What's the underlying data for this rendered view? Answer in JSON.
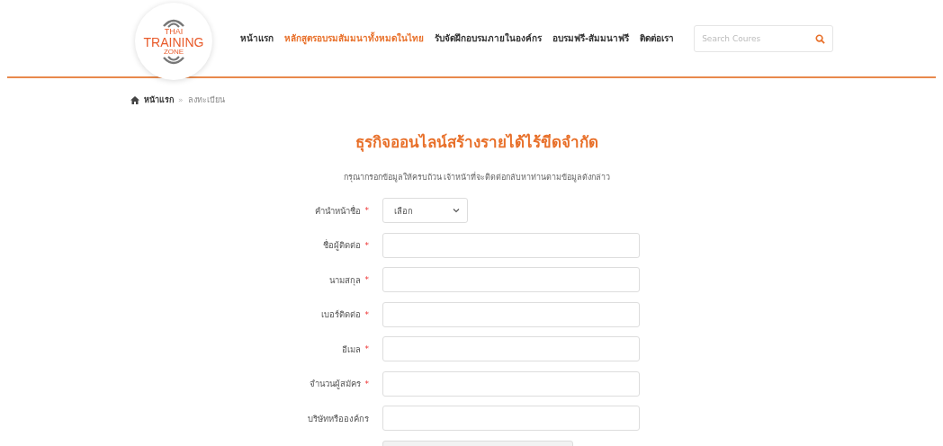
{
  "logo": {
    "lines": [
      "THAI",
      "TRAINING",
      "ZONE"
    ]
  },
  "nav": [
    {
      "label": "หน้าแรก",
      "selected": false
    },
    {
      "label": "หลักสูตรอบรมสัมมนาทั้งหมดในไทย",
      "selected": true
    },
    {
      "label": "รับจัดฝึกอบรมภายในองค์กร",
      "selected": false
    },
    {
      "label": "อบรมฟรี-สัมมนาฟรี",
      "selected": false
    },
    {
      "label": "ติดต่อเรา",
      "selected": false
    }
  ],
  "search": {
    "placeholder": "Search Coures"
  },
  "breadcrumb": [
    {
      "label": "หน้าแรก"
    },
    {
      "label": "ลงทะเบียน"
    }
  ],
  "breadcrumb_separator": "»",
  "title": "ธุรกิจออนไลน์สร้างรายได้ไร้ขีดจำกัด",
  "subtitle": "กรุณากรอกข้อมูลให้ครบถ้วน เจ้าหน้าที่จะติดต่อกลับหาท่านตามข้อมูลดังกล่าว",
  "required_mark": "*",
  "fields": [
    {
      "label": "คำนำหน้าชื่อ",
      "kind": "select",
      "value": "เลือก",
      "required": true
    },
    {
      "label": "ชื่อผู้ติดต่อ",
      "kind": "text",
      "required": true
    },
    {
      "label": "นามสกุล",
      "kind": "text",
      "required": true
    },
    {
      "label": "เบอร์ติดต่อ",
      "kind": "text",
      "required": true
    },
    {
      "label": "อีเมล",
      "kind": "text",
      "required": true
    },
    {
      "label": "จำนวนผู้สมัคร",
      "kind": "text",
      "required": true
    },
    {
      "label": "บริษัทหรือองค์กร",
      "kind": "text",
      "required": false
    },
    {
      "kind": "partial"
    }
  ]
}
